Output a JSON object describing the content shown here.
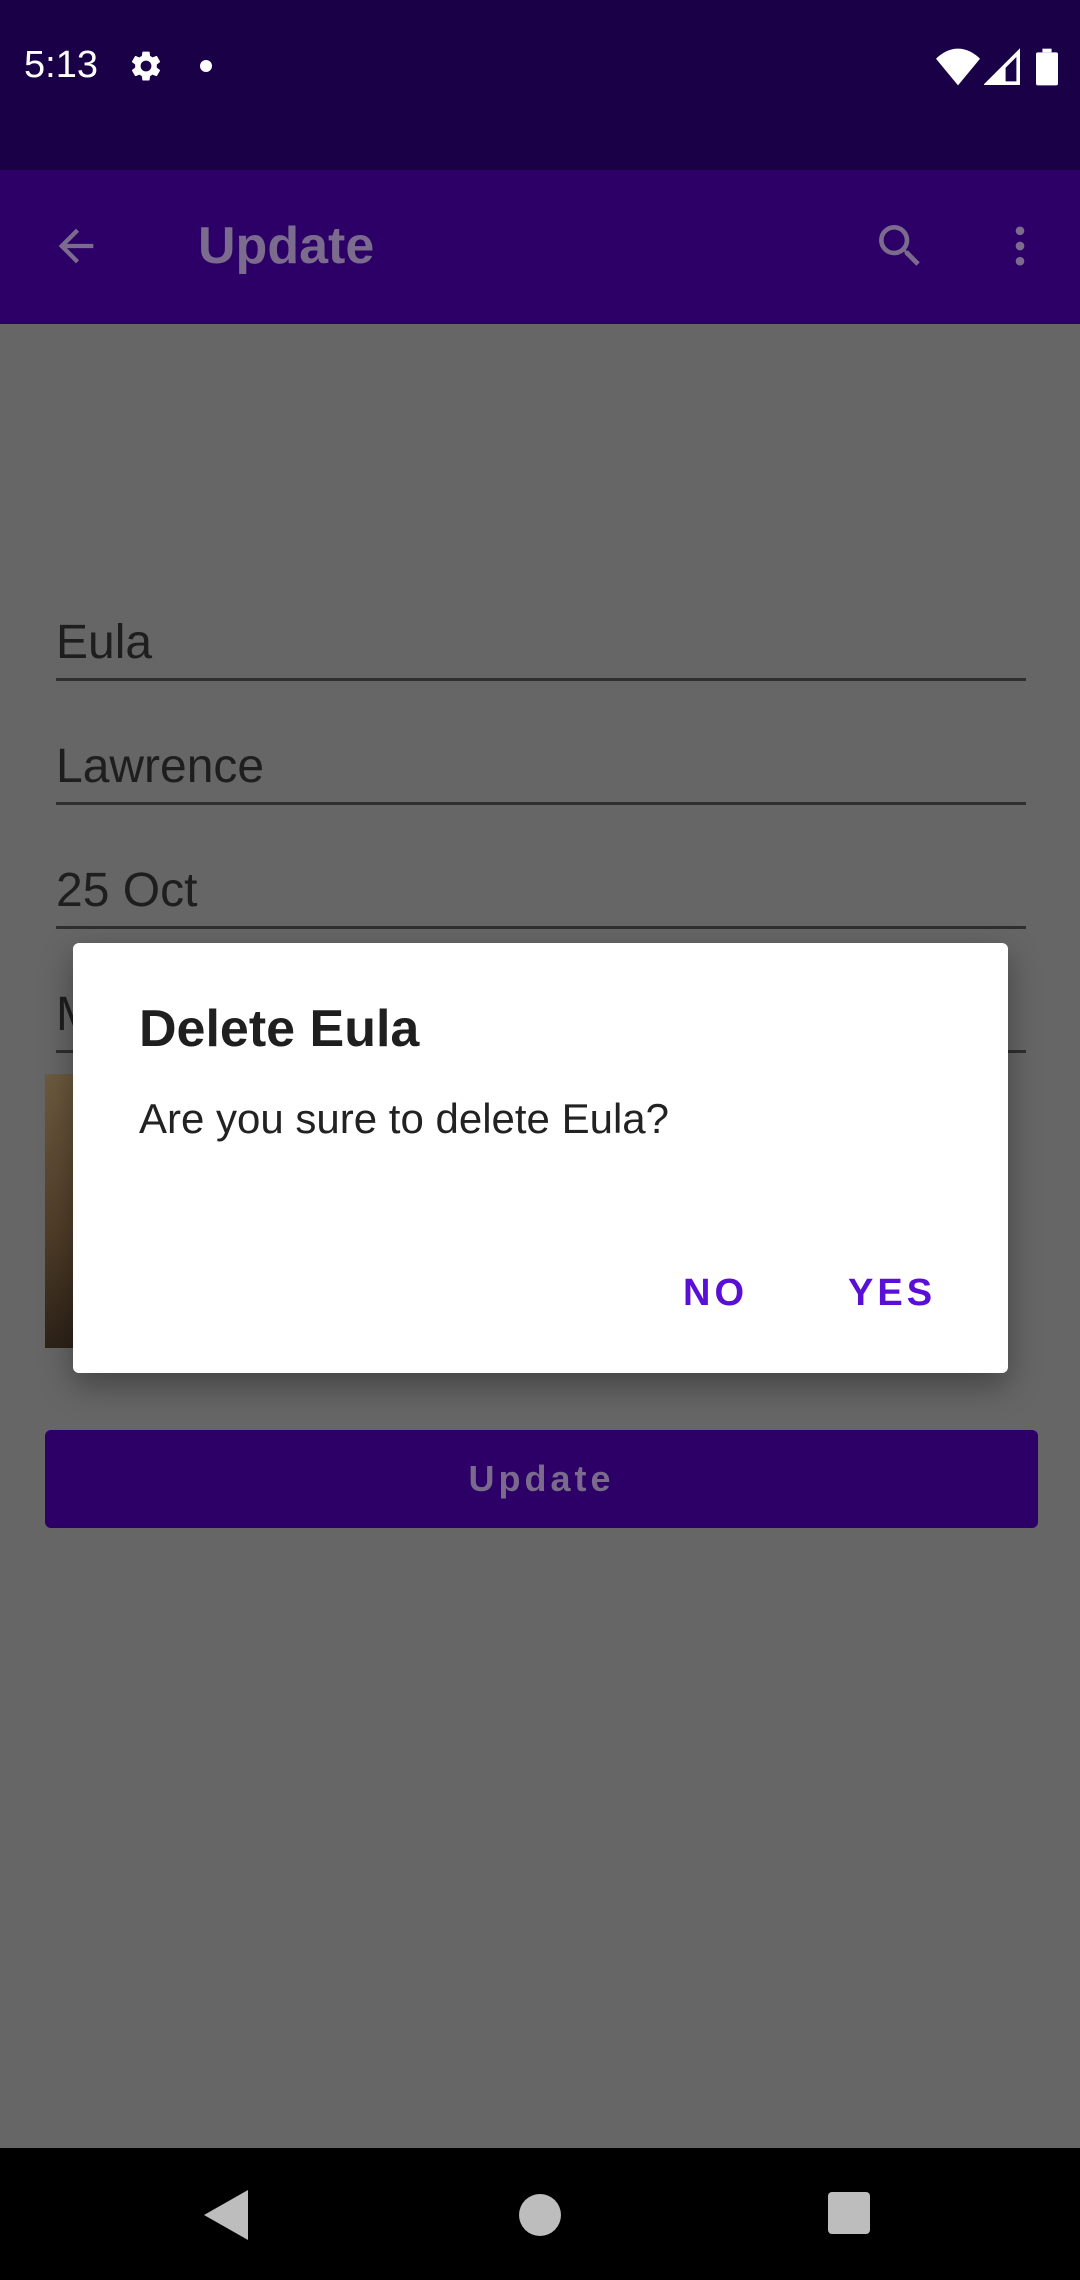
{
  "status_bar": {
    "time": "5:13",
    "icons": [
      "gear-icon",
      "notification-dot-icon",
      "wifi-icon",
      "signal-icon",
      "battery-icon"
    ]
  },
  "app_bar": {
    "title": "Update",
    "icons": [
      "arrow-back-icon",
      "search-icon",
      "more-vert-icon"
    ]
  },
  "form": {
    "first_name": "Eula",
    "last_name": "Lawrence",
    "date": "25 Oct",
    "partial_field_visible": "M",
    "update_label": "Update"
  },
  "dialog": {
    "title": "Delete Eula",
    "message": "Are you sure to delete Eula?",
    "no_label": "NO",
    "yes_label": "YES"
  },
  "colors": {
    "status_bar": "#1a0046",
    "app_bar": "#2c0067",
    "dialog_button": "#5a0fd8",
    "scrim_background": "#666666"
  },
  "nav_bar": {
    "icons": [
      "nav-back-icon",
      "nav-home-icon",
      "nav-recents-icon"
    ]
  }
}
